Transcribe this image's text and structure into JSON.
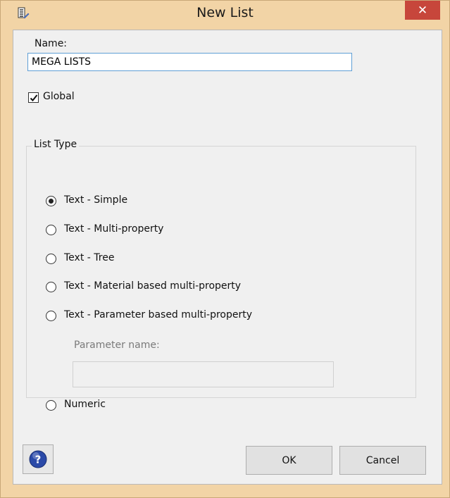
{
  "window": {
    "title": "New List",
    "close_glyph": "✕"
  },
  "form": {
    "name_label": "Name:",
    "name_value": "MEGA LISTS",
    "global_label": "Global",
    "global_checked": true
  },
  "list_type": {
    "legend": "List Type",
    "options": [
      {
        "label": "Text - Simple",
        "selected": true
      },
      {
        "label": "Text - Multi-property",
        "selected": false
      },
      {
        "label": "Text - Tree",
        "selected": false
      },
      {
        "label": "Text - Material based multi-property",
        "selected": false
      },
      {
        "label": "Text - Parameter based multi-property",
        "selected": false
      },
      {
        "label": "Numeric",
        "selected": false
      }
    ],
    "parameter_name_label": "Parameter name:",
    "parameter_name_value": ""
  },
  "buttons": {
    "help_glyph": "?",
    "ok": "OK",
    "cancel": "Cancel"
  },
  "icons": {
    "app": "list-editor-icon",
    "close": "close-icon",
    "help": "help-icon",
    "check": "checkmark-icon"
  },
  "colors": {
    "titlebar": "#f2d4a6",
    "close_button": "#c7463b",
    "input_focus_border": "#5f9fd6",
    "help_icon": "#2b4aa8"
  }
}
